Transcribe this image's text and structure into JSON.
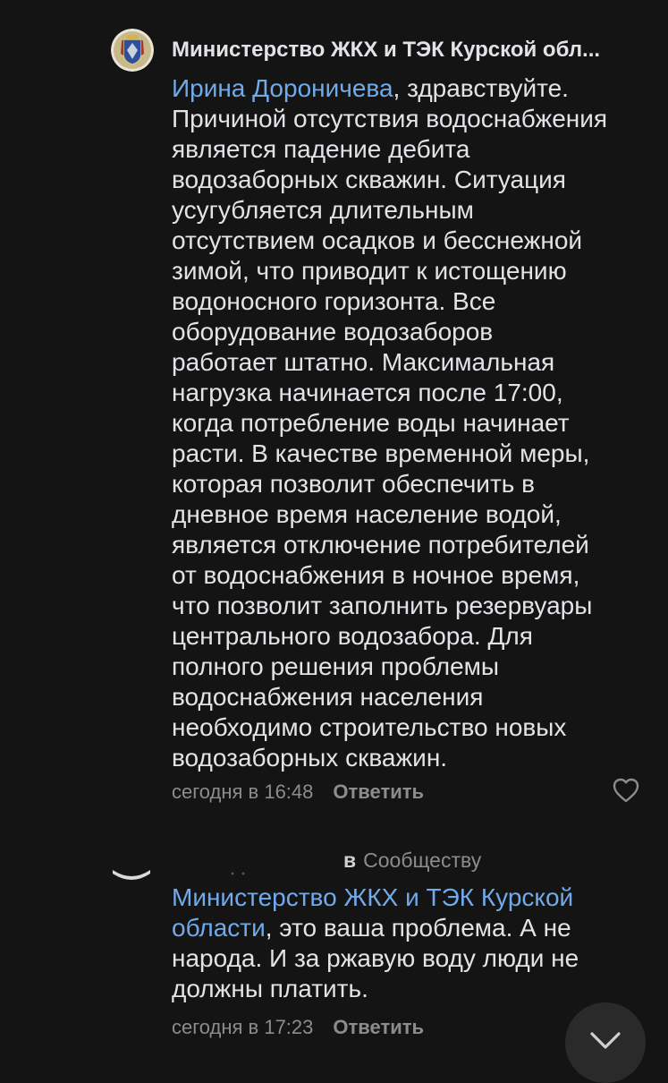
{
  "comment1": {
    "author": "Министерство ЖКХ и ТЭК Курской обл...",
    "mention": "Ирина Дороничева",
    "text": ", здравствуйте.\nПричиной отсутствия водоснабжения\nявляется падение дебита\nводозаборных скважин. Ситуация\nусугубляется длительным\nотсутствием осадков и бесснежной\nзимой, что приводит к истощению\nводоносного горизонта. Все\nоборудование водозаборов\nработает штатно. Максимальная\nнагрузка начинается после 17:00,\nкогда потребление воды начинает\nрасти. В качестве временной меры,\nкоторая позволит обеспечить в\nдневное время население водой,\nявляется отключение потребителей\nот водоснабжения в ночное время,\nчто позволит заполнить резервуары\nцентрального водозабора. Для\nполного решения проблемы\nводоснабжения населения\nнеобходимо строительство новых\nводозаборных скважин.",
    "time": "сегодня в 16:48",
    "reply_label": "Ответить",
    "like_icon": "heart-outline-icon",
    "avatar_icon": "coat-of-arms-icon"
  },
  "comment2": {
    "reply_prep": "в",
    "reply_to": "Сообществу",
    "mention": "Министерство ЖКХ и ТЭК Курской\nобласти",
    "text": ", это ваша проблема. А не\nнарода. И за ржавую воду люди не\nдолжны платить.",
    "time": "сегодня в 17:23",
    "reply_label": "Ответить"
  },
  "scroll_down": {
    "icon": "chevron-down-icon"
  },
  "colors": {
    "background": "#141414",
    "text": "#e1e3e6",
    "link": "#71aaeb",
    "secondary": "#8c8c8c"
  }
}
